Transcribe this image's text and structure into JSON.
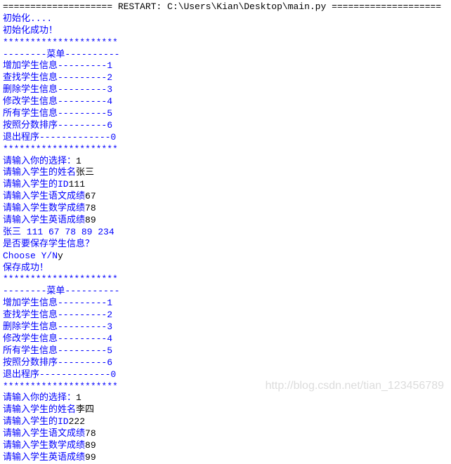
{
  "restart_line": "==================== RESTART: C:\\Users\\Kian\\Desktop\\main.py ====================",
  "lines": [
    {
      "t": "初始化....",
      "u": ""
    },
    {
      "t": "初始化成功！",
      "u": ""
    },
    {
      "t": "*********************",
      "u": ""
    },
    {
      "t": "--------菜单----------",
      "u": ""
    },
    {
      "t": "增加学生信息---------1",
      "u": ""
    },
    {
      "t": "查找学生信息---------2",
      "u": ""
    },
    {
      "t": "删除学生信息---------3",
      "u": ""
    },
    {
      "t": "修改学生信息---------4",
      "u": ""
    },
    {
      "t": "所有学生信息---------5",
      "u": ""
    },
    {
      "t": "按照分数排序---------6",
      "u": ""
    },
    {
      "t": "退出程序-------------0",
      "u": ""
    },
    {
      "t": "*********************",
      "u": ""
    },
    {
      "t": "请输入你的选择：",
      "u": "1"
    },
    {
      "t": "请输入学生的姓名",
      "u": "张三"
    },
    {
      "t": "请输入学生的ID",
      "u": "111"
    },
    {
      "t": "请输入学生语文成绩",
      "u": "67"
    },
    {
      "t": "请输入学生数学成绩",
      "u": "78"
    },
    {
      "t": "请输入学生英语成绩",
      "u": "89"
    },
    {
      "t": "张三 111 67 78 89 234",
      "u": ""
    },
    {
      "t": "是否要保存学生信息？",
      "u": ""
    },
    {
      "t": "Choose Y/N",
      "u": "y"
    },
    {
      "t": "保存成功！",
      "u": ""
    },
    {
      "t": "*********************",
      "u": ""
    },
    {
      "t": "--------菜单----------",
      "u": ""
    },
    {
      "t": "增加学生信息---------1",
      "u": ""
    },
    {
      "t": "查找学生信息---------2",
      "u": ""
    },
    {
      "t": "删除学生信息---------3",
      "u": ""
    },
    {
      "t": "修改学生信息---------4",
      "u": ""
    },
    {
      "t": "所有学生信息---------5",
      "u": ""
    },
    {
      "t": "按照分数排序---------6",
      "u": ""
    },
    {
      "t": "退出程序-------------0",
      "u": ""
    },
    {
      "t": "*********************",
      "u": ""
    },
    {
      "t": "请输入你的选择：",
      "u": "1"
    },
    {
      "t": "请输入学生的姓名",
      "u": "李四"
    },
    {
      "t": "请输入学生的ID",
      "u": "222"
    },
    {
      "t": "请输入学生语文成绩",
      "u": "78"
    },
    {
      "t": "请输入学生数学成绩",
      "u": "89"
    },
    {
      "t": "请输入学生英语成绩",
      "u": "99"
    }
  ],
  "watermark": "http://blog.csdn.net/tian_123456789"
}
